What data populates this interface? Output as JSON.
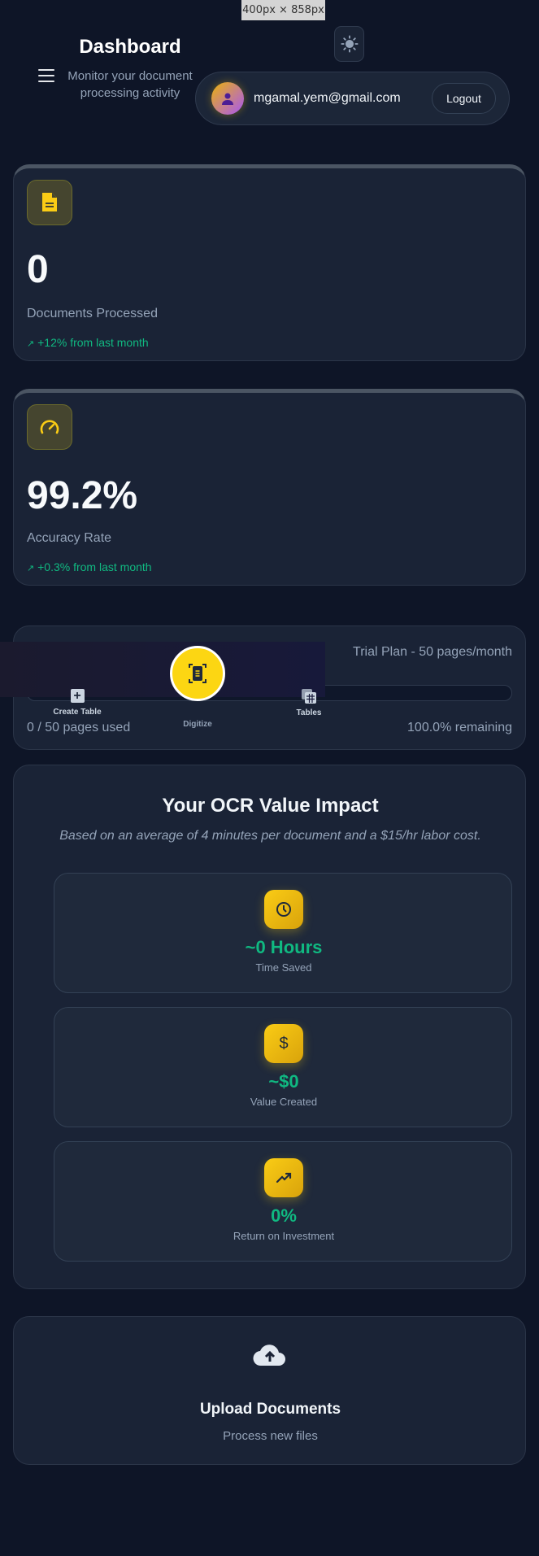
{
  "viewport_badge": "400px × 858px",
  "header": {
    "title": "Dashboard",
    "subtitle": "Monitor your document processing activity",
    "email": "mgamal.yem@gmail.com",
    "logout_label": "Logout"
  },
  "stats": [
    {
      "value": "0",
      "label": "Documents Processed",
      "trend": "+12% from last month",
      "icon": "document-icon"
    },
    {
      "value": "99.2%",
      "label": "Accuracy Rate",
      "trend": "+0.3% from last month",
      "icon": "gauge-icon"
    }
  ],
  "trend_arrow": "↗",
  "plan": {
    "name": "Trial Plan - 50 pages/month",
    "used": "0 / 50 pages used",
    "remaining": "100.0% remaining",
    "usage_fraction": 0
  },
  "bottom_nav": {
    "create_table": "Create Table",
    "digitize": "Digitize",
    "tables": "Tables"
  },
  "impact": {
    "title": "Your OCR Value Impact",
    "subtitle": "Based on an average of 4 minutes per document and a $15/hr labor cost.",
    "items": [
      {
        "value": "~0 Hours",
        "label": "Time Saved",
        "icon": "clock-icon"
      },
      {
        "value": "~$0",
        "label": "Value Created",
        "icon": "dollar-icon"
      },
      {
        "value": "0%",
        "label": "Return on Investment",
        "icon": "trending-up-icon"
      }
    ]
  },
  "upload": {
    "title": "Upload Documents",
    "subtitle": "Process new files"
  },
  "colors": {
    "background": "#0e1527",
    "card": "#1a2336",
    "accent_yellow": "#facc15",
    "positive_green": "#10b981"
  }
}
